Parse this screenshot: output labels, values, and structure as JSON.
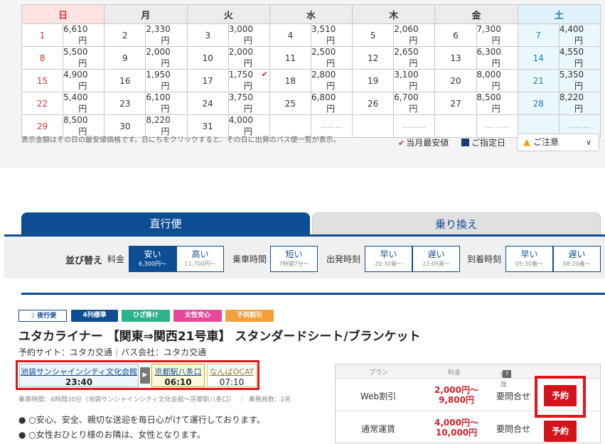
{
  "calendar": {
    "weekdays": [
      "日",
      "月",
      "火",
      "水",
      "木",
      "金",
      "土"
    ],
    "rows": [
      [
        {
          "d": "1",
          "p": "6,610円"
        },
        {
          "d": "2",
          "p": "2,330円"
        },
        {
          "d": "3",
          "p": "3,000円"
        },
        {
          "d": "4",
          "p": "3,510円"
        },
        {
          "d": "5",
          "p": "2,060円"
        },
        {
          "d": "6",
          "p": "7,300円"
        },
        {
          "d": "7",
          "p": "4,400円"
        }
      ],
      [
        {
          "d": "8",
          "p": "5,500円"
        },
        {
          "d": "9",
          "p": "2,000円"
        },
        {
          "d": "10",
          "p": "2,000円"
        },
        {
          "d": "11",
          "p": "2,500円"
        },
        {
          "d": "12",
          "p": "2,650円"
        },
        {
          "d": "13",
          "p": "6,300円"
        },
        {
          "d": "14",
          "p": "4,550円"
        }
      ],
      [
        {
          "d": "15",
          "p": "4,900円"
        },
        {
          "d": "16",
          "p": "1,950円"
        },
        {
          "d": "17",
          "p": "1,750円"
        },
        {
          "d": "18",
          "p": "2,800円"
        },
        {
          "d": "19",
          "p": "3,100円"
        },
        {
          "d": "20",
          "p": "8,000円"
        },
        {
          "d": "21",
          "p": "5,350円"
        }
      ],
      [
        {
          "d": "22",
          "p": "5,400円"
        },
        {
          "d": "23",
          "p": "6,100円"
        },
        {
          "d": "24",
          "p": "3,750円"
        },
        {
          "d": "25",
          "p": "6,800円"
        },
        {
          "d": "26",
          "p": "6,700円"
        },
        {
          "d": "27",
          "p": "8,500円"
        },
        {
          "d": "28",
          "p": "8,220円"
        }
      ],
      [
        {
          "d": "29",
          "p": "8,500円"
        },
        {
          "d": "30",
          "p": "8,220円"
        },
        {
          "d": "31",
          "p": "4,000円"
        },
        {
          "d": "",
          "p": "………"
        },
        {
          "d": "",
          "p": "………"
        },
        {
          "d": "",
          "p": "………"
        },
        {
          "d": "",
          "p": "………"
        }
      ]
    ],
    "note": "表示金額はその日の最安値価格です。日にちをクリックすると、その日に出発のバス便一覧が表示。",
    "legend_lowest": "当月最安値",
    "legend_selected": "ご指定日",
    "caution": "ご注意"
  },
  "tabs": {
    "direct": "直行便",
    "transfer": "乗り換え"
  },
  "sort": {
    "title": "並び替え",
    "price_label": "料金",
    "cheap": "安い",
    "cheap_sub": "6,300円〜",
    "high": "高い",
    "high_sub": "11,700円〜",
    "ride_label": "乗車時間",
    "short": "短い",
    "short_sub": "7時間7分〜",
    "dep_label": "出発時刻",
    "dep_early": "早い",
    "dep_early_sub": "20:30発〜",
    "dep_late": "遅い",
    "dep_late_sub": "23:05発〜",
    "arr_label": "到着時刻",
    "arr_early": "早い",
    "arr_early_sub": "05:30着〜",
    "arr_late": "遅い",
    "arr_late_sub": "08:20着〜"
  },
  "bus": {
    "badges": [
      "夜行便",
      "4列標準",
      "ひざ掛け",
      "女性安心",
      "子供割引"
    ],
    "title": "ユタカライナー 【関東⇒関西21号車】 スタンダードシート/ブランケット",
    "site": "予約サイト：ユタカ交通",
    "company": "バス会社：ユタカ交通",
    "dep_stop": "池袋サンシャインシティ文化会館",
    "dep_time": "23:40",
    "arr1_stop": "京都駅八条口",
    "arr1_time": "06:10",
    "arr2_stop": "なんばOCAT",
    "arr2_time": "07:10",
    "ride_info": "乗車時間：6時間30分（池袋サンシャインシティ文化会館〜京都駅八条口）",
    "crew": "乗務員数：2名",
    "bullet1": "● ○安心、安全、親切な送迎を毎日心がけて運行しております。",
    "bullet2": "● ○女性おひとり様のお隣は、女性となります。"
  },
  "plans": {
    "h_plan": "プラン",
    "h_price": "料金",
    "h_seat": "残席",
    "rows": [
      {
        "name": "Web割引",
        "price1": "2,000円〜",
        "price2": "9,800円",
        "avail": "要問合せ",
        "btn": "予約"
      },
      {
        "name": "通常運賃",
        "price1": "4,000円〜",
        "price2": "10,000円",
        "avail": "要問合せ",
        "btn": "予約"
      }
    ]
  },
  "colors": {
    "brand": "#0d4d93",
    "accent_red": "#d4141b",
    "highlight": "#e0161b"
  }
}
